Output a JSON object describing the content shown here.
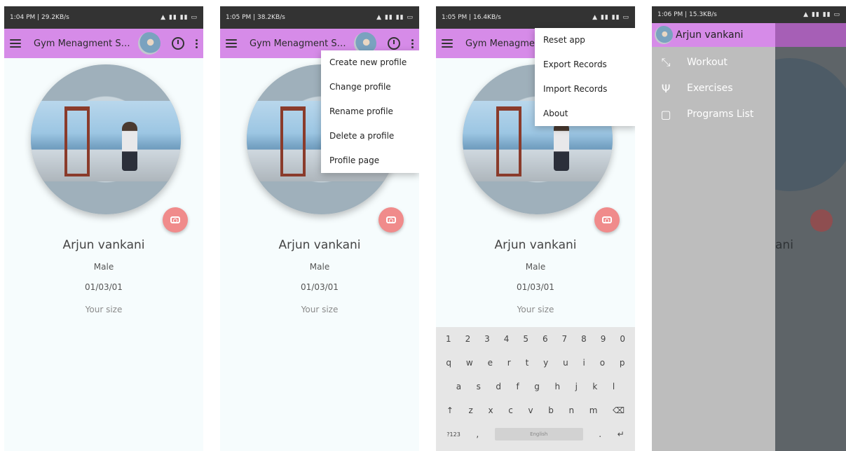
{
  "screens": [
    {
      "status": "1:04 PM | 29.2KB/s",
      "title": "Gym Menagment Syst...",
      "profile": {
        "name": "Arjun vankani",
        "gender": "Male",
        "dob": "01/03/01",
        "size": "Your size"
      }
    },
    {
      "status": "1:05 PM | 38.2KB/s",
      "title": "Gym Menagment Syst...",
      "menu": [
        "Create new profile",
        "Change profile",
        "Rename profile",
        "Delete a profile",
        "Profile page"
      ],
      "profile": {
        "name": "Arjun vankani",
        "gender": "Male",
        "dob": "01/03/01",
        "size": "Your size"
      }
    },
    {
      "status": "1:05 PM | 16.4KB/s",
      "title": "Gym Menagmen",
      "menu": [
        "Reset app",
        "Export Records",
        "Import Records",
        "About"
      ],
      "profile": {
        "name": "Arjun vankani",
        "gender": "Male",
        "dob": "01/03/01",
        "size": "Your size"
      },
      "keyboard": {
        "row1": [
          "1",
          "2",
          "3",
          "4",
          "5",
          "6",
          "7",
          "8",
          "9",
          "0"
        ],
        "row2": [
          "q",
          "w",
          "e",
          "r",
          "t",
          "y",
          "u",
          "i",
          "o",
          "p"
        ],
        "row3": [
          "a",
          "s",
          "d",
          "f",
          "g",
          "h",
          "j",
          "k",
          "l"
        ],
        "row4": [
          "↑",
          "z",
          "x",
          "c",
          "v",
          "b",
          "n",
          "m",
          "⌫"
        ],
        "row5_left": "?123",
        "comma": ",",
        "space": "English",
        "period": ".",
        "enter": "↵"
      }
    },
    {
      "status": "1:06 PM | 15.3KB/s",
      "drawer": {
        "header": "Arjun vankani",
        "items": [
          "Workout",
          "Exercises",
          "Programs List"
        ]
      },
      "partial_name": "ani"
    }
  ],
  "colors": {
    "appbar": "#d68be8",
    "fab": "#f08b8b",
    "background": "#f6fcfd",
    "drawer": "#bdbdbd"
  },
  "icons": [
    "menu-icon",
    "timer-icon",
    "more-vert-icon",
    "camera-icon",
    "workout-icon",
    "exercises-icon",
    "programs-list-icon"
  ]
}
